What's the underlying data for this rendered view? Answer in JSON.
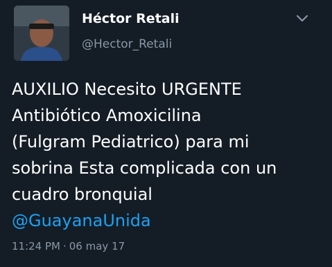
{
  "tweet": {
    "author": {
      "display_name": "Héctor Retali",
      "handle": "@Hector_Retali",
      "avatar_icon": "user-avatar"
    },
    "menu_icon": "chevron-down-icon",
    "text_lines": [
      "AUXILIO Necesito URGENTE",
      "Antibiótico Amoxicilina",
      "(Fulgram Pediatrico) para mi",
      "sobrina Esta complicada con un",
      "cuadro bronquial"
    ],
    "mention": "@GuayanaUnida",
    "time": "11:24 PM",
    "separator": "·",
    "date": "06 may 17",
    "colors": {
      "background": "#141d26",
      "text": "#ffffff",
      "secondary": "#8899a6",
      "link": "#1da1f2"
    }
  }
}
